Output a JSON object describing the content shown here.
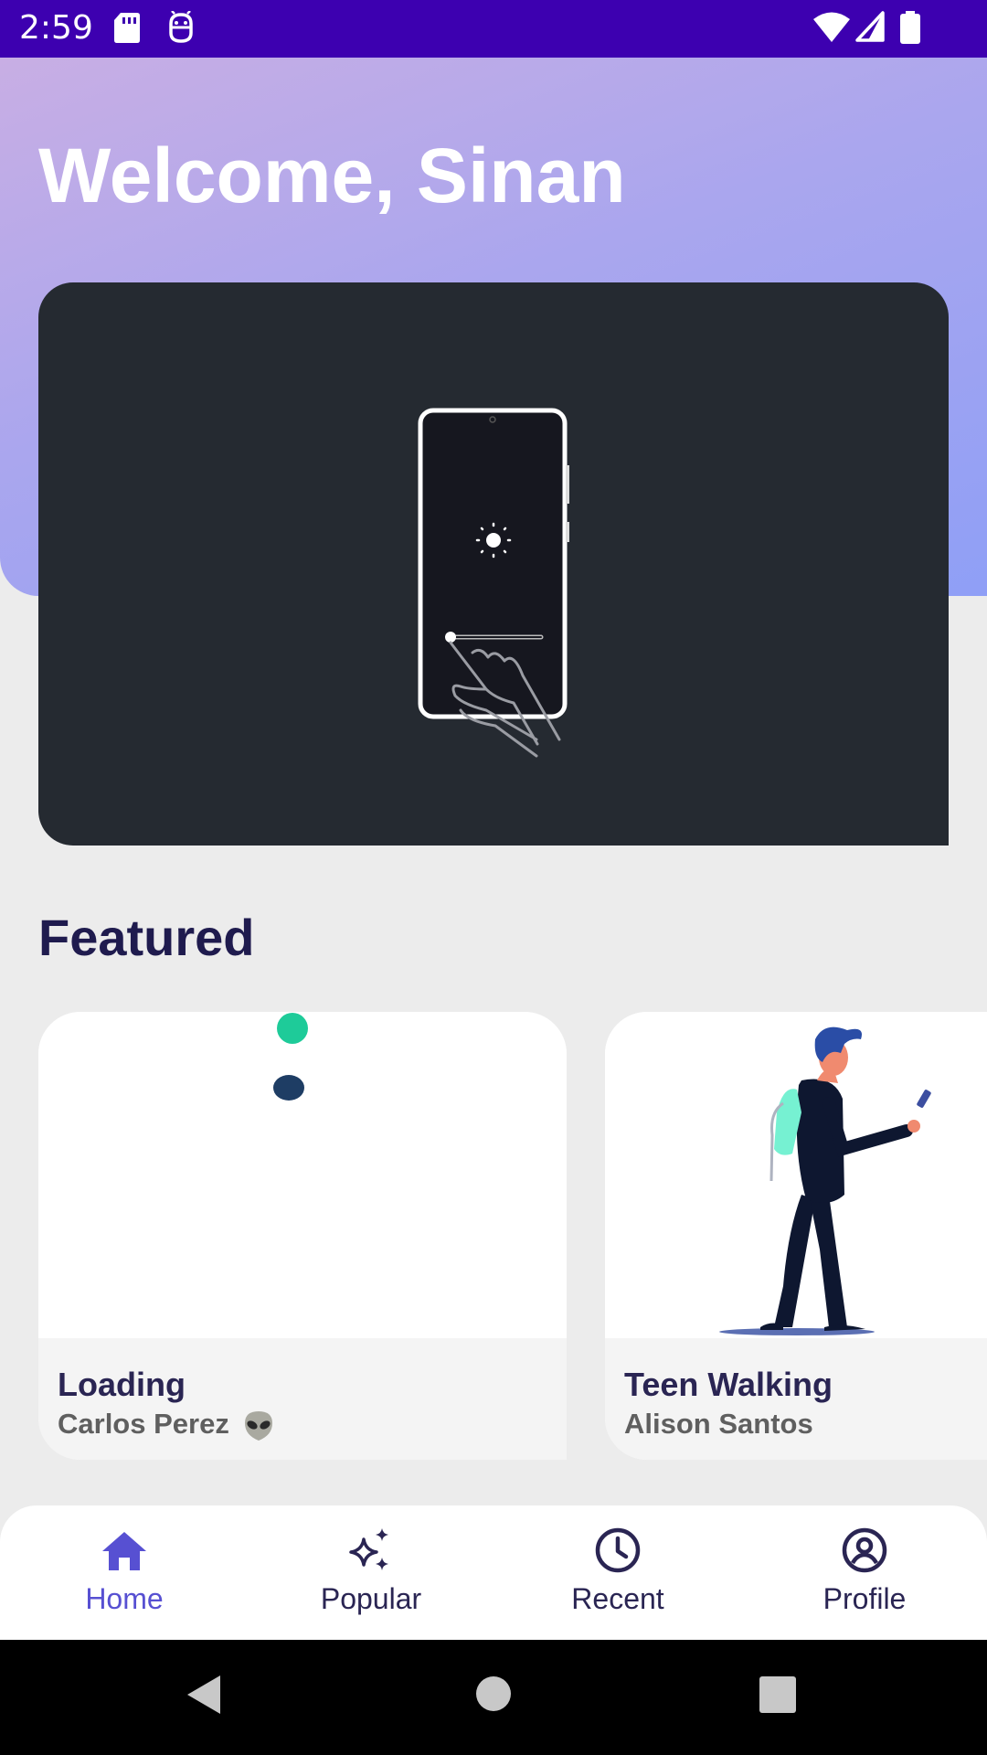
{
  "status_bar": {
    "time": "2:59",
    "icons": [
      "sd-card-icon",
      "android-debug-icon",
      "wifi-icon",
      "cell-signal-icon",
      "battery-icon"
    ]
  },
  "header": {
    "greeting": "Welcome, Sinan",
    "gradient_colors": [
      "#c8aee4",
      "#aaa6ee",
      "#8f9ff6"
    ]
  },
  "hero": {
    "illustration": "phone-brightness-swipe-illustration",
    "background": "#252a31"
  },
  "featured": {
    "title": "Featured",
    "cards": [
      {
        "title": "Loading",
        "author": "Carlos Perez",
        "author_emoji": "alien-emoji-icon",
        "image": "loading-dots-animation"
      },
      {
        "title": "Teen Walking",
        "author": "Alison Santos",
        "image": "teen-walking-illustration"
      }
    ]
  },
  "bottom_nav": {
    "items": [
      {
        "label": "Home",
        "icon": "home-icon",
        "active": true
      },
      {
        "label": "Popular",
        "icon": "sparkles-icon",
        "active": false
      },
      {
        "label": "Recent",
        "icon": "clock-icon",
        "active": false
      },
      {
        "label": "Profile",
        "icon": "profile-icon",
        "active": false
      }
    ],
    "active_color": "#5750d2",
    "inactive_color": "#2a2553"
  },
  "system_nav": [
    "back-button",
    "home-button",
    "recents-button"
  ]
}
